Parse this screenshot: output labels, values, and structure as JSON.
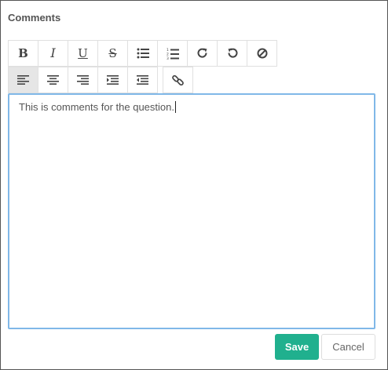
{
  "dialog": {
    "title": "Comments"
  },
  "toolbar": {
    "row1": [
      {
        "name": "bold",
        "icon": "bold-icon",
        "glyph": "B"
      },
      {
        "name": "italic",
        "icon": "italic-icon",
        "glyph": "I"
      },
      {
        "name": "underline",
        "icon": "underline-icon",
        "glyph": "U"
      },
      {
        "name": "strikethrough",
        "icon": "strikethrough-icon",
        "glyph": "S"
      },
      {
        "name": "bulleted-list",
        "icon": "bulleted-list-icon"
      },
      {
        "name": "numbered-list",
        "icon": "numbered-list-icon"
      },
      {
        "name": "redo",
        "icon": "redo-icon"
      },
      {
        "name": "undo",
        "icon": "undo-icon"
      },
      {
        "name": "clear-formatting",
        "icon": "clear-formatting-icon"
      }
    ],
    "row2": [
      {
        "name": "align-left",
        "icon": "align-left-icon",
        "active": true
      },
      {
        "name": "align-center",
        "icon": "align-center-icon"
      },
      {
        "name": "align-right",
        "icon": "align-right-icon"
      },
      {
        "name": "indent",
        "icon": "indent-icon"
      },
      {
        "name": "outdent",
        "icon": "outdent-icon"
      },
      {
        "name": "insert-link",
        "icon": "link-icon"
      }
    ]
  },
  "editor": {
    "content": "This is comments for the question."
  },
  "actions": {
    "save_label": "Save",
    "cancel_label": "Cancel"
  },
  "colors": {
    "save_bg": "#20b08e",
    "editor_border": "#80b8e8",
    "active_tool_bg": "#e6e6e6"
  }
}
